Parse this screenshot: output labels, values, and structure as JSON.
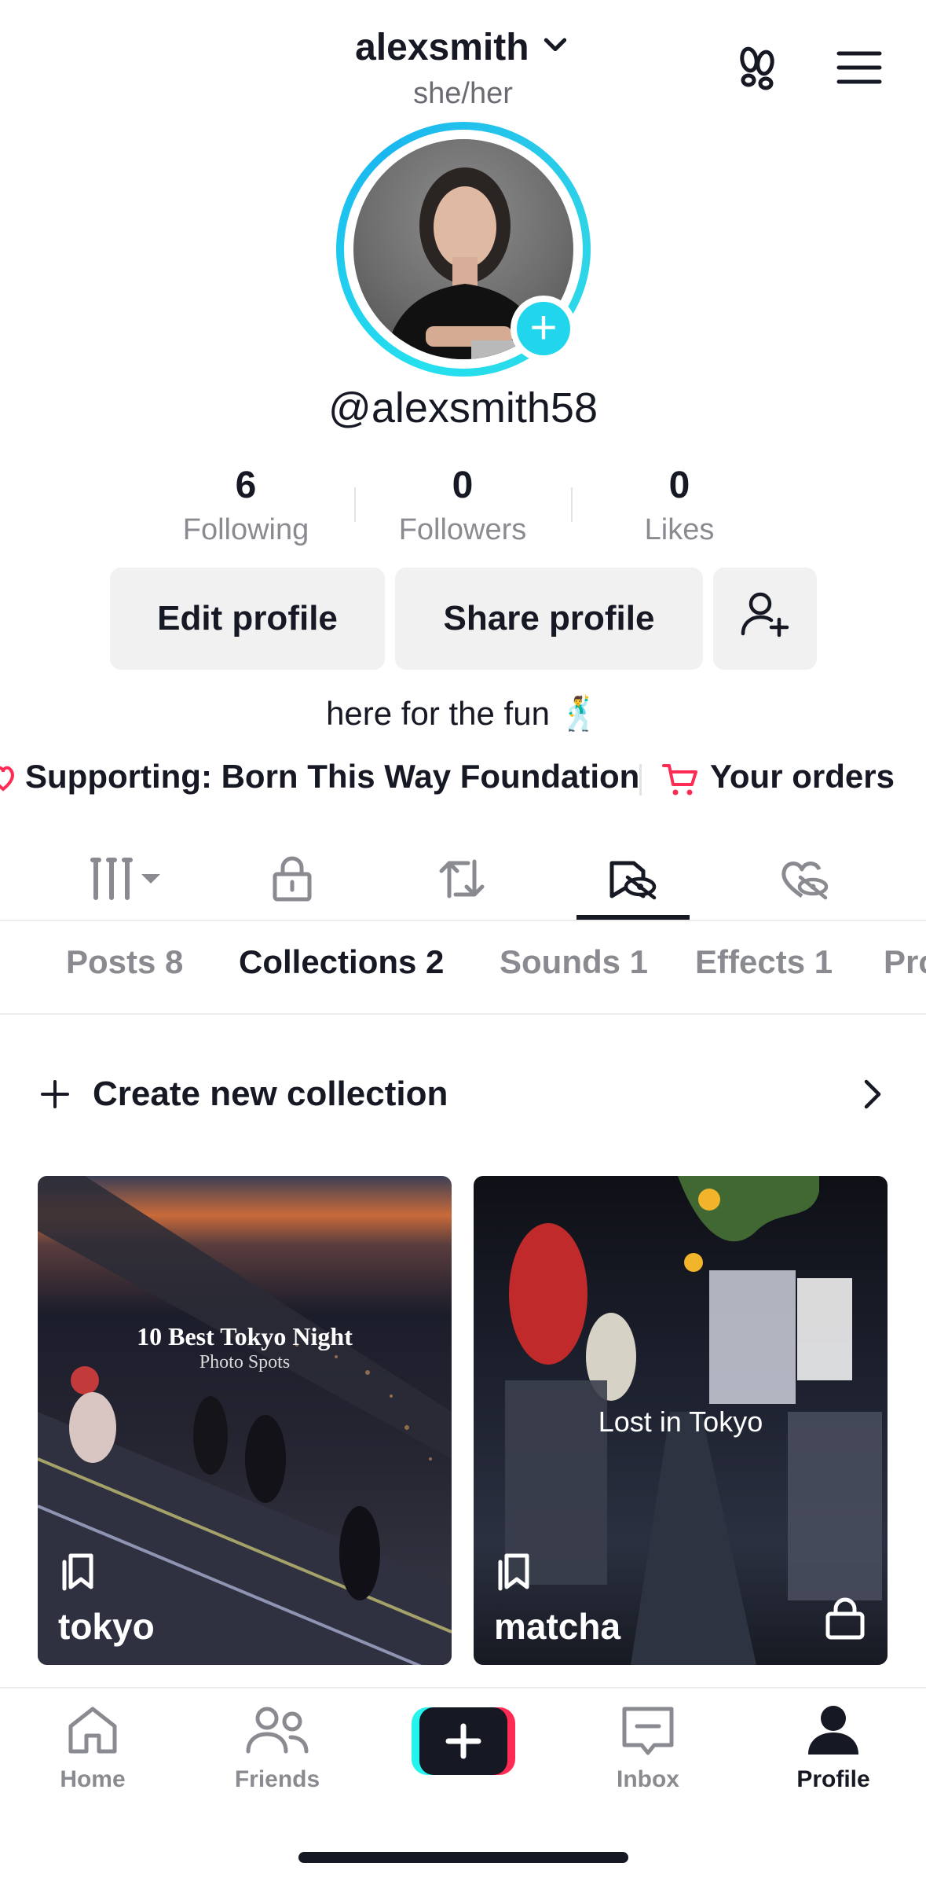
{
  "header": {
    "username": "alexsmith",
    "pronouns": "she/her",
    "handle": "@alexsmith58"
  },
  "stats": [
    {
      "value": "6",
      "label": "Following"
    },
    {
      "value": "0",
      "label": "Followers"
    },
    {
      "value": "0",
      "label": "Likes"
    }
  ],
  "actions": {
    "edit": "Edit profile",
    "share": "Share profile"
  },
  "bio": "here for the fun 🕺",
  "links": {
    "supporting": "Supporting: Born This Way Foundation",
    "orders": "Your orders"
  },
  "icon_tabs": [
    "grid-icon",
    "lock-icon",
    "repost-icon",
    "favorites-hidden-icon",
    "liked-hidden-icon"
  ],
  "content_tabs": [
    "Posts 8",
    "Collections 2",
    "Sounds 1",
    "Effects 1",
    "Pro"
  ],
  "active_content_tab": "Collections 2",
  "create_collection": "Create new collection",
  "collections": [
    {
      "name": "tokyo",
      "cover_title": "10 Best Tokyo Night",
      "cover_subtitle": "Photo Spots",
      "locked": false
    },
    {
      "name": "matcha",
      "cover_title": "Lost in Tokyo",
      "cover_subtitle": "",
      "locked": true
    }
  ],
  "nav": {
    "home": "Home",
    "friends": "Friends",
    "inbox": "Inbox",
    "profile": "Profile"
  },
  "colors": {
    "accent_cyan": "#20d5ec",
    "accent_red": "#fe2c55",
    "text": "#161823",
    "muted": "#8a8b91"
  }
}
